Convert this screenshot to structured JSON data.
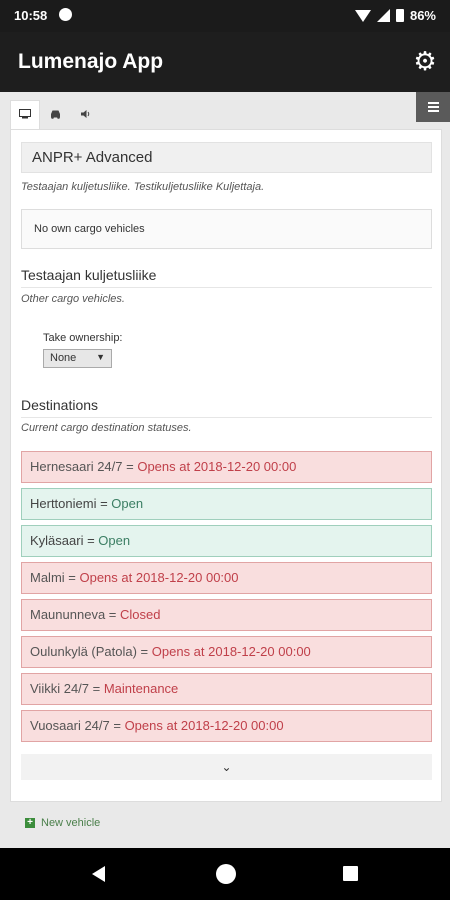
{
  "statusbar": {
    "time": "10:58",
    "battery": "86%"
  },
  "appbar": {
    "title": "Lumenajo App"
  },
  "tabs": [
    {
      "icon": "monitor-icon",
      "glyph": "▭"
    },
    {
      "icon": "car-icon",
      "glyph": "⛟"
    },
    {
      "icon": "speaker-icon",
      "glyph": "🔈"
    }
  ],
  "app": {
    "header": "ANPR+ Advanced",
    "subtitle": "Testaajan kuljetusliike. Testikuljetusliike Kuljettaja.",
    "own_vehicles": "No own cargo vehicles"
  },
  "company": {
    "title": "Testaajan kuljetusliike",
    "subtitle": "Other cargo vehicles.",
    "ownership_label": "Take ownership:",
    "ownership_value": "None"
  },
  "destinations": {
    "title": "Destinations",
    "subtitle": "Current cargo destination statuses.",
    "items": [
      {
        "name": "Hernesaari 24/7 = ",
        "status": "Opens at 2018-12-20 00:00",
        "state": "red"
      },
      {
        "name": "Herttoniemi = ",
        "status": "Open",
        "state": "green"
      },
      {
        "name": "Kyläsaari = ",
        "status": "Open",
        "state": "green"
      },
      {
        "name": "Malmi = ",
        "status": "Opens at 2018-12-20 00:00",
        "state": "red"
      },
      {
        "name": "Maununneva = ",
        "status": "Closed",
        "state": "red"
      },
      {
        "name": "Oulunkylä (Patola) = ",
        "status": "Opens at 2018-12-20 00:00",
        "state": "red"
      },
      {
        "name": "Viikki 24/7 = ",
        "status": "Maintenance",
        "state": "red"
      },
      {
        "name": "Vuosaari 24/7 = ",
        "status": "Opens at 2018-12-20 00:00",
        "state": "red"
      }
    ],
    "expand_glyph": "⌄"
  },
  "footer": {
    "new_vehicle": "New vehicle"
  },
  "colors": {
    "red_bg": "#f9dede",
    "green_bg": "#e4f4ee",
    "status_red": "#c0404a",
    "appbar": "#1e1e1e"
  }
}
